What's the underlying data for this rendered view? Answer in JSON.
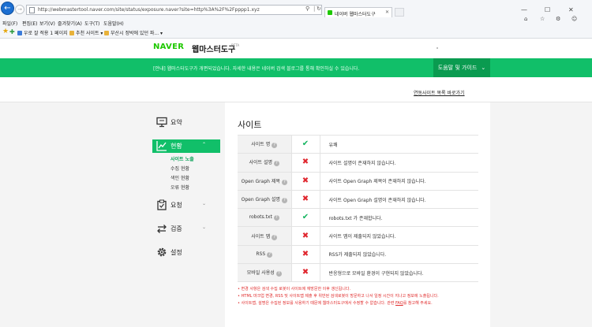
{
  "browser": {
    "back_icon": "back-arrow-icon",
    "url": "http://webmastertool.naver.com/site/status/exposure.naver?site=http%3A%2F%2Fpppp1.xyz",
    "tab_title": "네이버 웹마스터도구",
    "menu": [
      "파일(F)",
      "편집(E)",
      "보기(V)",
      "즐겨찾기(A)",
      "도구(T)",
      "도움말(H)"
    ],
    "favorites": [
      "우로 잘 적용 1 페이지 ...",
      "추천 사이트 ▾",
      "부산시 정박에 있던 파... ▾"
    ],
    "window_controls": [
      "—",
      "☐",
      "✕"
    ],
    "toolbar_icons": [
      "home-icon",
      "star-icon",
      "gear-icon",
      "smiley-icon"
    ]
  },
  "header": {
    "logo": "NAVER",
    "tool_name": "웹마스터도구",
    "beta": "BETA"
  },
  "notice": {
    "text": "[안내] 웹마스터도구가 개편되었습니다. 자세한 내용은 네이버 검색 블로그를 통해 확인하실 수 있습니다.",
    "guide_button": "도움말 및 가이드"
  },
  "site_switch_link": "연동사이트 목록 바로가기",
  "sidebar": {
    "items": [
      {
        "label": "요약",
        "icon": "monitor-icon",
        "active": false,
        "has_chevron": false
      },
      {
        "label": "현황",
        "icon": "trend-chart-icon",
        "active": true,
        "has_chevron": true
      },
      {
        "label": "요청",
        "icon": "clipboard-icon",
        "active": false,
        "has_chevron": true
      },
      {
        "label": "검증",
        "icon": "sync-arrows-icon",
        "active": false,
        "has_chevron": true
      },
      {
        "label": "설정",
        "icon": "gear-icon",
        "active": false,
        "has_chevron": false
      }
    ],
    "sub_items": [
      "사이트 노출",
      "수집 현황",
      "색인 현황",
      "오류 현황"
    ]
  },
  "panel": {
    "title": "사이트",
    "rows": [
      {
        "name": "사이트 명",
        "help": true,
        "status": "ok",
        "desc": "유쾌"
      },
      {
        "name": "사이트 설명",
        "help": true,
        "status": "fail",
        "desc": "사이트 설명이 존재하지 않습니다."
      },
      {
        "name": "Open Graph 제목",
        "help": true,
        "status": "fail",
        "desc": "사이트 Open Graph 제목이 존재하지 않습니다."
      },
      {
        "name": "Open Graph 설명",
        "help": true,
        "status": "fail",
        "desc": "사이트 Open Graph 설명이 존재하지 않습니다."
      },
      {
        "name": "robots.txt",
        "help": true,
        "status": "ok",
        "desc": "robots.txt 가 존재합니다."
      },
      {
        "name": "사이트 맵",
        "help": true,
        "status": "fail",
        "desc": "사이트 맵이 제출되지 않았습니다."
      },
      {
        "name": "RSS",
        "help": true,
        "status": "fail",
        "desc": "RSS가 제출되지 않았습니다."
      },
      {
        "name": "모바일 사용성",
        "help": true,
        "status": "fail",
        "desc": "반응형으로 모바일 환경이 구현되지 않았습니다."
      }
    ],
    "notes": [
      "• 변경 사항은 검색 수집 로봇이 사이트에 재방문한 이후 갱신됩니다.",
      "• HTML 마크업 변경, RSS 및 사이트맵 제출 후 위반된 검색로봇이 방문하고 나서 일정 시간이 지나고 정보에 노출됩니다.",
      "• 사이트맵, 설명은 수집된 정보를 사용하기 때문에 웹마스터도구에서 수정할 수 없습니다. 관련"
    ],
    "notes_link": "FAQ",
    "notes_tail": "를 참고해 주세요."
  }
}
